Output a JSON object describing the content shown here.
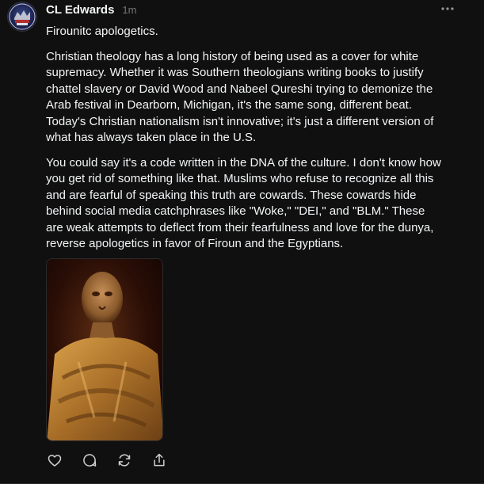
{
  "post": {
    "author": "CL Edwards",
    "timestamp": "1m",
    "title": "Firounitc apologetics.",
    "paragraphs": [
      "Christian theology has a long history of being used as a cover for white supremacy. Whether it was Southern theologians writing books to justify chattel slavery or David Wood and Nabeel Qureshi trying to demonize the Arab festival in Dearborn, Michigan, it's the same song, different beat. Today's Christian nationalism isn't innovative; it's just a different version of what has always taken place in the U.S.",
      "You could say it's a code written in the DNA of the culture. I don't know how you get rid of something like that. Muslims who refuse to recognize all this and are fearful of speaking this truth are cowards. These cowards hide behind social media catchphrases like \"Woke,\" \"DEI,\" and \"BLM.\" These are weak attempts to deflect from their fearfulness and love for the dunya, reverse apologetics in favor of Firoun and the Egyptians."
    ]
  },
  "icons": {
    "more": "more-horizontal-icon",
    "like": "heart-icon",
    "reply": "comment-icon",
    "repost": "repost-icon",
    "share": "share-icon"
  },
  "colors": {
    "background": "#101010",
    "text": "#f3f5f7",
    "muted": "#777777"
  }
}
